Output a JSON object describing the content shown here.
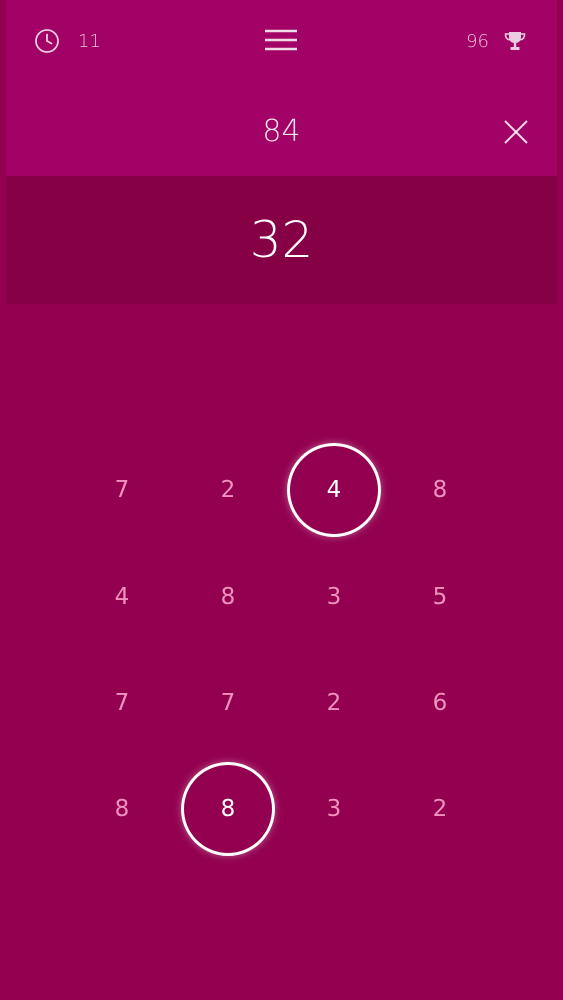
{
  "header": {
    "timer": {
      "icon": "clock-icon",
      "value": "11"
    },
    "menu": {
      "icon": "hamburger-menu-icon"
    },
    "score": {
      "value": "96",
      "icon": "trophy-icon"
    },
    "target": "84",
    "close": {
      "icon": "close-icon"
    }
  },
  "current_value": "32",
  "grid": {
    "rows": [
      [
        "7",
        "2",
        "4",
        "8"
      ],
      [
        "4",
        "8",
        "3",
        "5"
      ],
      [
        "7",
        "7",
        "2",
        "6"
      ],
      [
        "8",
        "8",
        "3",
        "2"
      ]
    ],
    "selected": [
      [
        0,
        2
      ],
      [
        3,
        1
      ]
    ]
  },
  "colors": {
    "background": "#93004f",
    "top_panel": "#a20266",
    "current_panel": "#860046",
    "number_text": "#ffaad2",
    "selected_ring": "#ffffff"
  }
}
